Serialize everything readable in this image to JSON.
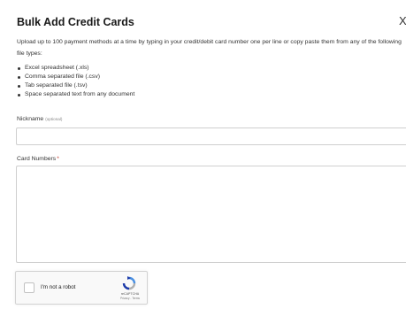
{
  "dialog": {
    "title": "Bulk Add Credit Cards",
    "close_glyph": "X",
    "description": "Upload up to 100 payment methods at a time by typing in your credit/debit card number one per line or copy paste them from any of the following file types:",
    "file_types": [
      "Excel spreadsheet (.xls)",
      "Comma separated file (.csv)",
      "Tab separated file (.tsv)",
      "Space separated text from any document"
    ]
  },
  "form": {
    "nickname_label": "Nickname",
    "nickname_optional": "(optional)",
    "nickname_value": "",
    "card_numbers_label": "Card Numbers",
    "card_numbers_required_mark": "*",
    "card_numbers_value": ""
  },
  "captcha": {
    "label": "I'm not a robot",
    "brand": "reCAPTCHA",
    "privacy": "Privacy",
    "separator": " - ",
    "terms": "Terms",
    "logo_icon": "recaptcha-logo-icon",
    "colors": {
      "blue": "#4a90e2",
      "dark_blue": "#1c3aa9",
      "grey": "#b0b0b0"
    }
  }
}
